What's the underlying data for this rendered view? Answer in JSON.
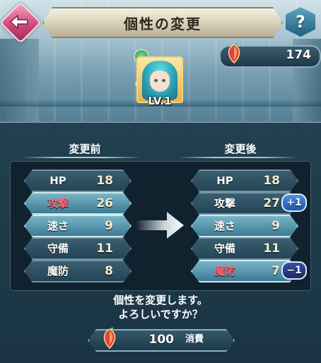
{
  "header": {
    "title": "個性の変更",
    "help_label": "?"
  },
  "resources": {
    "feathers": "174"
  },
  "unit": {
    "level": "LV.1"
  },
  "columns": {
    "before": "変更前",
    "after": "変更後"
  },
  "stats_before": [
    {
      "name": "HP",
      "value": "18"
    },
    {
      "name": "攻撃",
      "value": "26"
    },
    {
      "name": "速さ",
      "value": "9"
    },
    {
      "name": "守備",
      "value": "11"
    },
    {
      "name": "魔防",
      "value": "8"
    }
  ],
  "stats_after": [
    {
      "name": "HP",
      "value": "18"
    },
    {
      "name": "攻撃",
      "value": "27",
      "delta": "+1"
    },
    {
      "name": "速さ",
      "value": "9"
    },
    {
      "name": "守備",
      "value": "11"
    },
    {
      "name": "魔防",
      "value": "7",
      "delta": "−1"
    }
  ],
  "confirm": {
    "line1": "個性を変更します。",
    "line2": "よろしいですか？"
  },
  "cost": {
    "amount": "100",
    "label": "消費"
  },
  "colors": {
    "boon": "#ff6a78",
    "accent": "#6f95a7"
  },
  "icons": {
    "back": "back-arrow-icon",
    "help": "help-icon",
    "feather": "feather-gem-icon",
    "arrow": "right-arrow-icon"
  }
}
